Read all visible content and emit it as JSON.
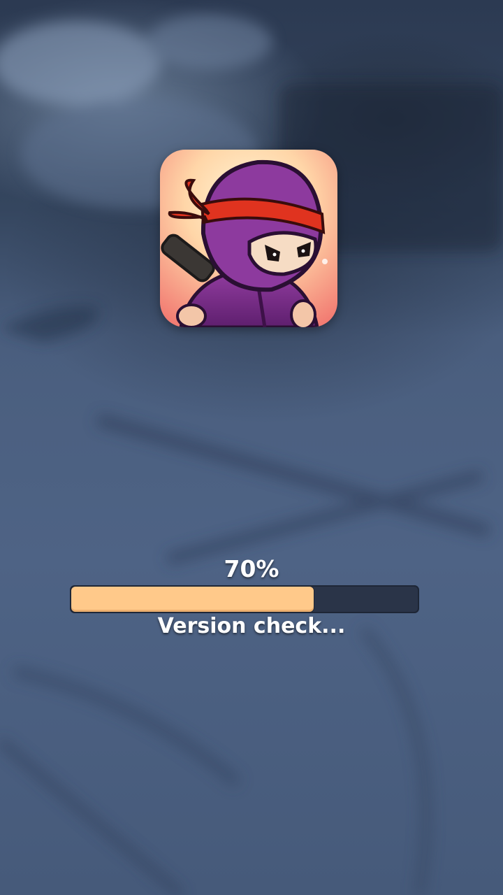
{
  "loading": {
    "percent_text": "70%",
    "progress": 0.7,
    "status_text": "Version check..."
  },
  "app_icon": {
    "icon_name": "ninja-character-icon"
  },
  "colors": {
    "progress_fill": "#ffc98a",
    "progress_track": "#2a3448",
    "text": "#ffffff"
  }
}
